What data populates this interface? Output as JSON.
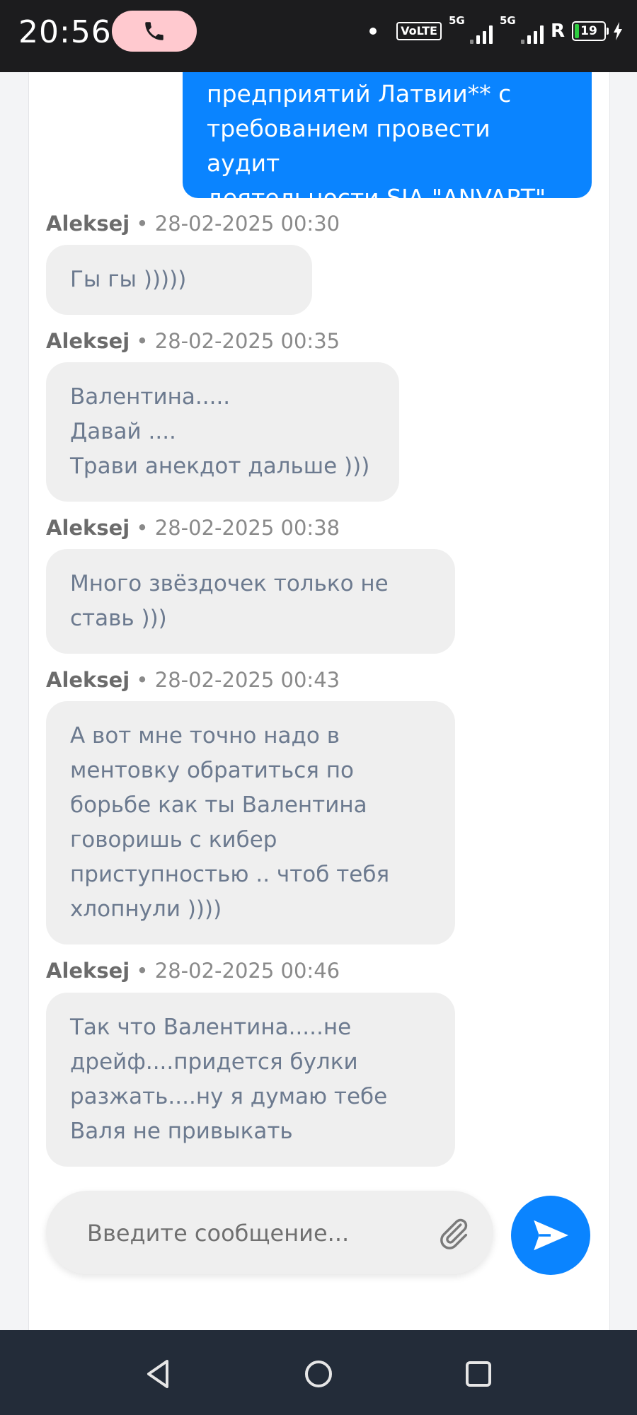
{
  "status_bar": {
    "time": "20:56",
    "volte": "VoLTE",
    "network1": "5G",
    "network2": "5G",
    "roaming": "R",
    "battery": "19"
  },
  "chat": {
    "outgoing_tail": "предприятий Латвии** с\nтребованием провести аудит\nдеятельности SIA \"ANVART\".",
    "messages": [
      {
        "author": "Aleksej",
        "sep": " • ",
        "time": "28-02-2025 00:30",
        "text": "Гы гы )))))"
      },
      {
        "author": "Aleksej",
        "sep": " • ",
        "time": "28-02-2025 00:35",
        "text": "Валентина.....\nДавай ....\nТрави анекдот дальше )))"
      },
      {
        "author": "Aleksej",
        "sep": " • ",
        "time": "28-02-2025 00:38",
        "text": "Много звёздочек только не\nставь )))"
      },
      {
        "author": "Aleksej",
        "sep": " • ",
        "time": "28-02-2025 00:43",
        "text": "А вот мне точно надо в\nментовку обратиться по\nборьбе как ты Валентина\nговоришь с кибер\nприступностью .. чтоб тебя\nхлопнули ))))"
      },
      {
        "author": "Aleksej",
        "sep": " • ",
        "time": "28-02-2025 00:46",
        "text": "Так что Валентина.....не\nдрейф....придется булки\nразжать....ну я думаю тебе\nВаля не привыкать"
      }
    ]
  },
  "composer": {
    "placeholder": "Введите сообщение..."
  },
  "colors": {
    "accent": "#0a84ff",
    "incoming_bubble": "#efefef",
    "incoming_text": "#6c7a8f",
    "nav_bar": "#232c39"
  },
  "icons": {
    "call": "phone-icon",
    "attach": "paperclip-icon",
    "send": "send-icon",
    "nav_back": "back-triangle-icon",
    "nav_home": "home-circle-icon",
    "nav_recents": "recents-square-icon"
  }
}
